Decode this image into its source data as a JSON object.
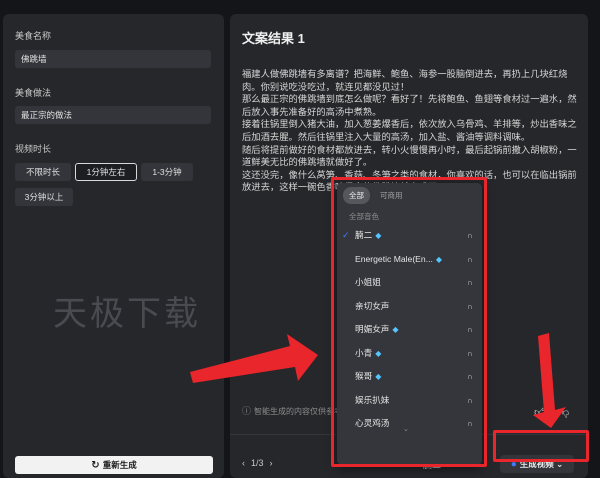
{
  "left": {
    "dish_label": "美食名称",
    "dish_value": "佛跳墙",
    "method_label": "美食做法",
    "method_value": "最正宗的做法",
    "duration_label": "视频时长",
    "durations": [
      "不限时长",
      "1分钟左右",
      "1-3分钟",
      "3分钟以上"
    ],
    "watermark": "天极下载",
    "regen_label": "重新生成"
  },
  "result": {
    "title": "文案结果 1",
    "paragraphs": [
      "福建人做佛跳墙有多离谱？把海鲜、鲍鱼、海参一股脑倒进去，再扔上几块红烧肉。你别说吃没吃过，就连见都没见过！",
      "那么最正宗的佛跳墙到底怎么做呢？看好了！先将鲍鱼、鱼翅等食材过一遍水，然后放入事先准备好的高汤中煮熟。",
      "接着往锅里倒入猪大油，加入葱姜爆香后，依次放入乌骨鸡、羊排等，炒出香味之后加酒去腥。然后往锅里注入大量的高汤，加入盐、酱油等调料调味。",
      "随后将提前做好的食材都放进去，转小火慢慢再小时，最后起锅前撒入胡椒粉，一道鲜美无比的佛跳墙就做好了。",
      "这还没完，像什么莴笋、香菇、冬笋之类的食材，你喜欢的话，也可以在临出锅前放进去，这样一碗色香味俱全的佛跳墙就完成了。"
    ],
    "ai_note": "智能生成的内容仅供参考",
    "pager": "1/3",
    "selected_voice": "腩二",
    "generate_label": "生成视频"
  },
  "voice_dropdown": {
    "tabs": [
      "全部",
      "可商用"
    ],
    "group_label": "全部音色",
    "items": [
      {
        "name": "腩二",
        "premium": true,
        "selected": true
      },
      {
        "name": "Energetic Male(En...",
        "premium": true,
        "selected": false
      },
      {
        "name": "小姐姐",
        "premium": false,
        "selected": false
      },
      {
        "name": "亲切女声",
        "premium": false,
        "selected": false
      },
      {
        "name": "明媚女声",
        "premium": true,
        "selected": false
      },
      {
        "name": "小青",
        "premium": true,
        "selected": false
      },
      {
        "name": "猴哥",
        "premium": true,
        "selected": false
      },
      {
        "name": "娱乐扒妹",
        "premium": false,
        "selected": false
      },
      {
        "name": "心灵鸡汤",
        "premium": false,
        "selected": false
      }
    ],
    "more_indicator": "⌄"
  },
  "icons": {
    "check": "check-icon",
    "premium": "diamond-icon",
    "preview": "headphones-icon",
    "like": "thumbs-up-icon",
    "dislike": "thumbs-down-icon",
    "refresh": "refresh-icon",
    "info": "info-icon",
    "voice": "voice-icon"
  },
  "colors": {
    "background": "#141518",
    "panel": "#26272b",
    "accent": "#3e7bff",
    "premium": "#55c4ff",
    "highlight": "#e8262b"
  }
}
